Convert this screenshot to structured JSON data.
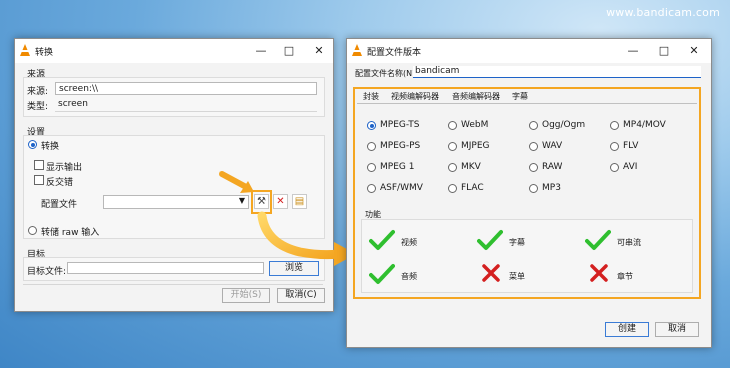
{
  "watermark": "www.bandicam.com",
  "left": {
    "title": "转换",
    "source_section": "来源",
    "source_label": "来源:",
    "source_value": "screen:\\\\",
    "type_label": "类型:",
    "type_value": "screen",
    "settings_section": "设置",
    "convert_label": "转换",
    "show_output": "显示输出",
    "deinterlace": "反交错",
    "profile_label": "配置文件",
    "dump_raw": "转储 raw 输入",
    "target_section": "目标",
    "target_file_label": "目标文件:",
    "browse": "浏览",
    "start": "开始(S)",
    "cancel": "取消(C)"
  },
  "right": {
    "title": "配置文件版本",
    "profile_name_label": "配置文件名称(N)",
    "profile_name_value": "bandicam",
    "tabs": [
      "封装",
      "视频编解码器",
      "音频编解码器",
      "字幕"
    ],
    "containers": [
      [
        "MPEG-TS",
        "WebM",
        "Ogg/Ogm",
        "MP4/MOV"
      ],
      [
        "MPEG-PS",
        "MJPEG",
        "WAV",
        "FLV"
      ],
      [
        "MPEG 1",
        "MKV",
        "RAW",
        "AVI"
      ],
      [
        "ASF/WMV",
        "FLAC",
        "MP3"
      ]
    ],
    "features_label": "功能",
    "features": [
      {
        "name": "视频",
        "enabled": true
      },
      {
        "name": "字幕",
        "enabled": true
      },
      {
        "name": "可串流",
        "enabled": true
      },
      {
        "name": "音频",
        "enabled": true
      },
      {
        "name": "菜单",
        "enabled": false
      },
      {
        "name": "章节",
        "enabled": false
      }
    ],
    "create": "创建",
    "cancel": "取消"
  },
  "colors": {
    "highlight": "#f4a622",
    "check": "#2fbf2f",
    "cross": "#d42020",
    "accent": "#1e63c8"
  }
}
